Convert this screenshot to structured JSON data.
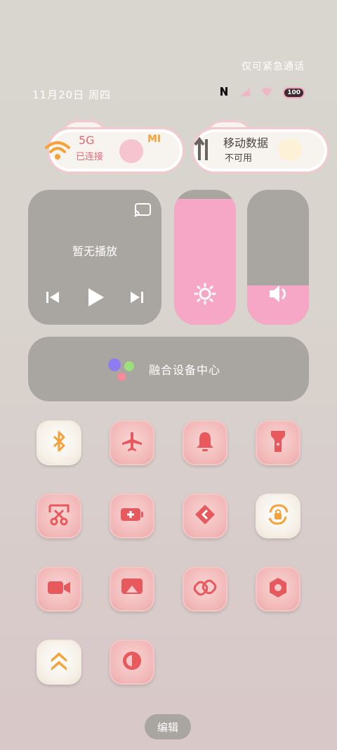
{
  "status_bar": {
    "emergency_text": "仅可紧急通话",
    "date_text": "11月20日 周四",
    "battery_text": "100"
  },
  "connectivity": {
    "wifi": {
      "title": "5G",
      "subtitle": "已连接",
      "icon": "wifi-icon",
      "badge": "MI"
    },
    "mobile": {
      "title": "移动数据",
      "subtitle": "不可用",
      "icon": "mobile-data-icon"
    }
  },
  "media": {
    "status_text": "暂无播放",
    "icons": [
      "cast-icon",
      "previous-icon",
      "play-icon",
      "next-icon"
    ]
  },
  "brightness": {
    "level_percent": 93,
    "icon": "sun-icon"
  },
  "volume": {
    "level_percent": 29,
    "icon": "speaker-icon"
  },
  "device_center": {
    "label": "融合设备中心"
  },
  "toggles": [
    {
      "name": "bluetooth",
      "icon": "bluetooth-icon",
      "active": true
    },
    {
      "name": "airplane-mode",
      "icon": "airplane-icon",
      "active": false
    },
    {
      "name": "ringer",
      "icon": "bell-icon",
      "active": false
    },
    {
      "name": "flashlight",
      "icon": "flashlight-icon",
      "active": false
    },
    {
      "name": "screenshot",
      "icon": "scissors-icon",
      "active": false
    },
    {
      "name": "battery-saver",
      "icon": "battery-plus-icon",
      "active": false
    },
    {
      "name": "nearby-share",
      "icon": "share-arrow-icon",
      "active": false
    },
    {
      "name": "rotation-lock",
      "icon": "rotate-lock-icon",
      "active": true
    },
    {
      "name": "screen-record",
      "icon": "video-camera-icon",
      "active": false
    },
    {
      "name": "screen-cast",
      "icon": "screencast-icon",
      "active": false
    },
    {
      "name": "link",
      "icon": "link-icon",
      "active": false
    },
    {
      "name": "settings",
      "icon": "hexagon-settings-icon",
      "active": false
    },
    {
      "name": "performance-mode",
      "icon": "chevrons-up-icon",
      "active": true
    },
    {
      "name": "dark-mode",
      "icon": "contrast-icon",
      "active": false
    }
  ],
  "edit_button": {
    "label": "编辑"
  },
  "colors": {
    "accent": "#e8595d",
    "active_orange": "#f6a23a",
    "slider_fill": "#f7a7c6",
    "panel": "#a9a6a2"
  }
}
